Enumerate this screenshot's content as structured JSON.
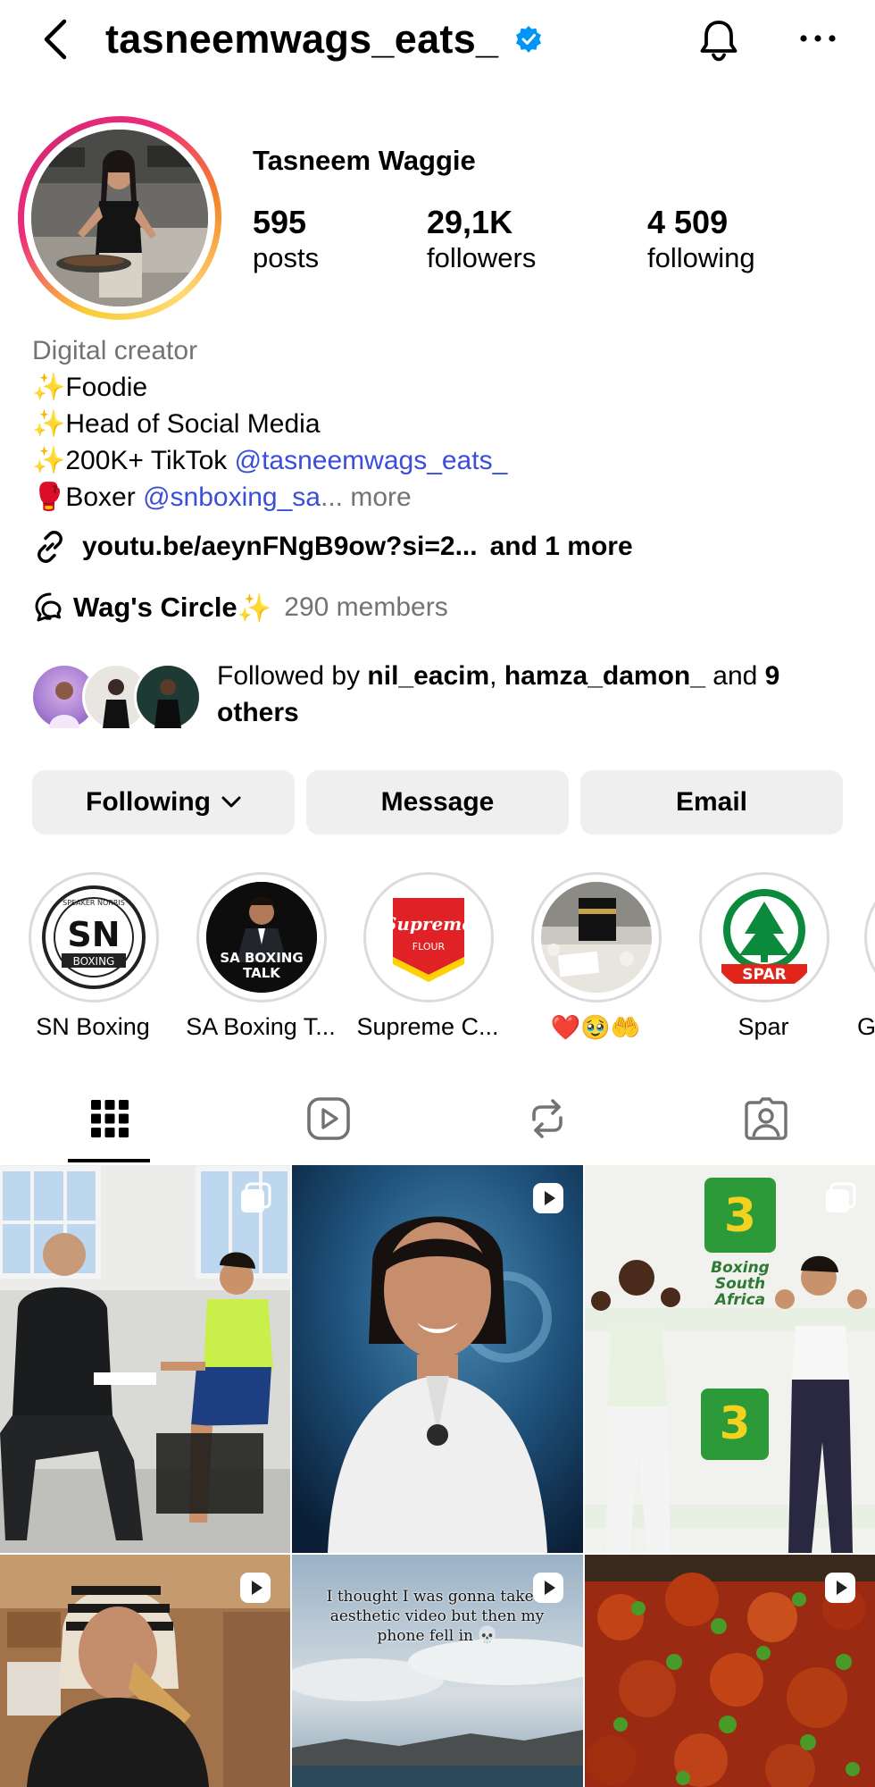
{
  "header": {
    "handle": "tasneemwags_eats_",
    "icons": {
      "back": "chevron-left-icon",
      "verified": "verified-badge-icon",
      "notifications": "bell-icon",
      "more": "more-horizontal-icon"
    }
  },
  "profile": {
    "display_name": "Tasneem Waggie",
    "stats": [
      {
        "value": "595",
        "label": "posts"
      },
      {
        "value": "29,1K",
        "label": "followers"
      },
      {
        "value": "4 509",
        "label": "following"
      }
    ],
    "category": "Digital creator",
    "bio_lines": [
      {
        "emoji": "✨",
        "text": "Foodie",
        "mention": "",
        "tail": ""
      },
      {
        "emoji": "✨",
        "text": "Head of Social Media",
        "mention": "",
        "tail": ""
      },
      {
        "emoji": "✨",
        "text": "200K+ TikTok ",
        "mention": "@tasneemwags_eats_",
        "tail": ""
      },
      {
        "emoji": "🥊",
        "text": "Boxer ",
        "mention": "@snboxing_sa",
        "tail": "... more"
      }
    ],
    "link": {
      "url": "youtu.be/aeynFNgB9ow?si=2...",
      "extra": "and 1 more"
    },
    "channel": {
      "name": "Wag's Circle",
      "emoji": "✨",
      "members": "290 members"
    },
    "followed_by": {
      "prefix": "Followed by ",
      "user1": "nil_eacim",
      "sep": ", ",
      "user2": "hamza_damon_",
      "and": " and ",
      "others": "9 others"
    }
  },
  "buttons": {
    "following": "Following",
    "message": "Message",
    "email": "Email"
  },
  "highlights": [
    {
      "label": "SN Boxing"
    },
    {
      "label": "SA Boxing T..."
    },
    {
      "label": "Supreme C..."
    },
    {
      "label": "❤️🥹🤲"
    },
    {
      "label": "Spar"
    },
    {
      "label": "G"
    }
  ],
  "highlight_art": {
    "sn_logo": "SN",
    "sn_sub": "BOXING",
    "sn_ring_text": "SPEAKER NORRIS",
    "sa_line1": "SA BOXING",
    "sa_line2": "TALK",
    "supreme_main": "Supreme",
    "supreme_sub": "FLOUR",
    "spar": "SPAR"
  },
  "tabs": [
    {
      "name": "grid",
      "icon": "grid-icon",
      "active": true
    },
    {
      "name": "reels",
      "icon": "reels-icon",
      "active": false
    },
    {
      "name": "reposts",
      "icon": "repost-icon",
      "active": false
    },
    {
      "name": "tagged",
      "icon": "tagged-icon",
      "active": false
    }
  ],
  "grid": {
    "post5_caption": "I thought I was gonna take a aesthetic video but then my phone fell in 💀",
    "post3_sign_lines": [
      "Boxing",
      "South",
      "Africa"
    ]
  }
}
